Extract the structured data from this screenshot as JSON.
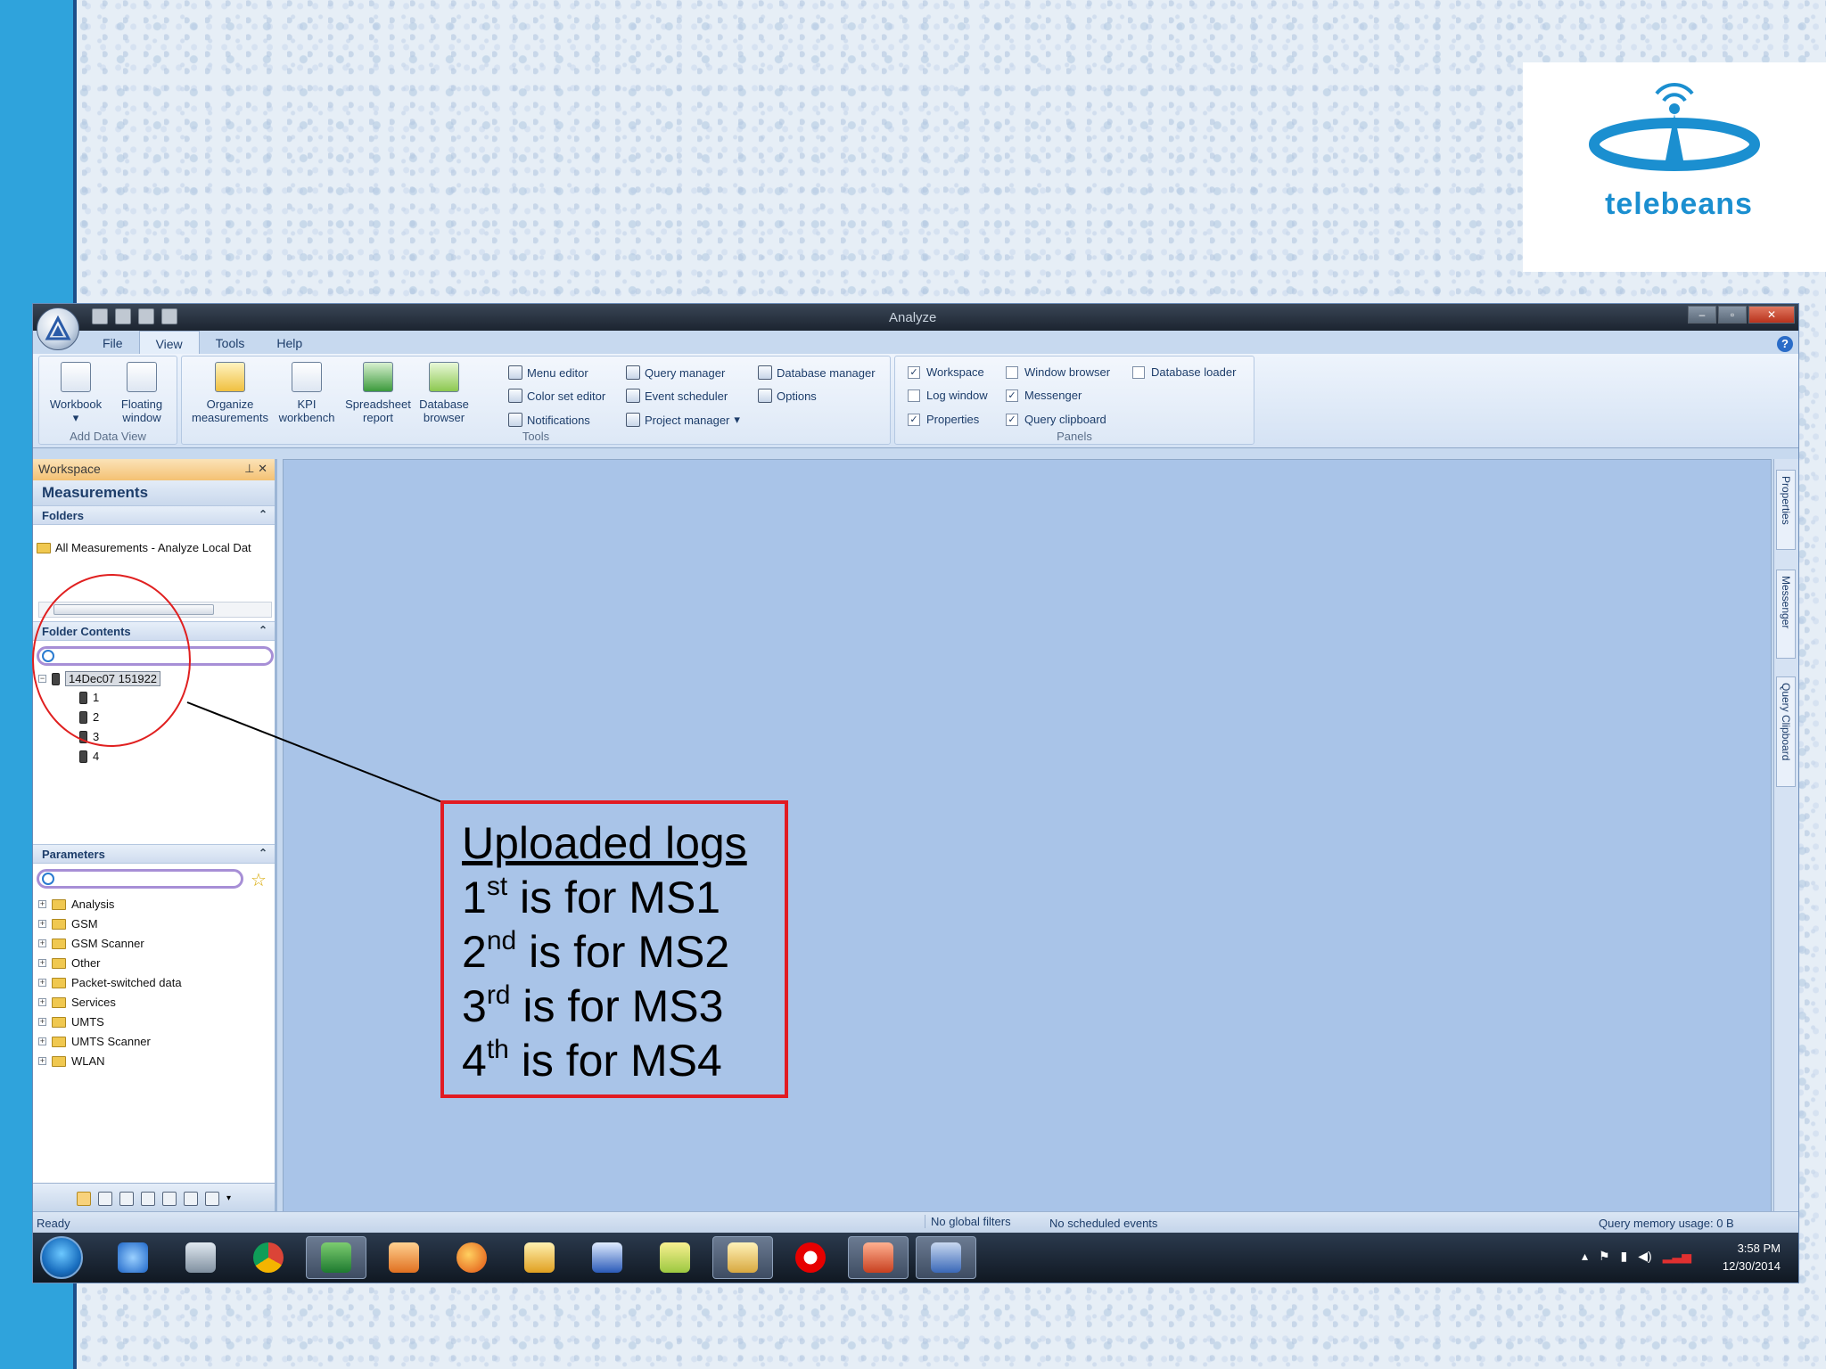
{
  "brand": {
    "logo_text": "telebeans"
  },
  "app": {
    "title": "Analyze",
    "menu_tabs": [
      {
        "label": "File"
      },
      {
        "label": "View"
      },
      {
        "label": "Tools"
      },
      {
        "label": "Help"
      }
    ],
    "active_tab": "View"
  },
  "ribbon": {
    "groups": [
      {
        "label": "Add Data View"
      },
      {
        "label": "Tools"
      },
      {
        "label": "Panels"
      }
    ],
    "add_data_view": {
      "workbook": "Workbook",
      "floating_window_1": "Floating",
      "floating_window_2": "window"
    },
    "tools_big": {
      "organize_1": "Organize",
      "organize_2": "measurements",
      "kpi_1": "KPI",
      "kpi_2": "workbench",
      "spreadsheet_1": "Spreadsheet",
      "spreadsheet_2": "report",
      "database_1": "Database",
      "database_2": "browser"
    },
    "tools_small": {
      "menu_editor": "Menu editor",
      "color_set_editor": "Color set editor",
      "notifications": "Notifications",
      "query_manager": "Query manager",
      "event_scheduler": "Event scheduler",
      "project_manager": "Project manager",
      "database_manager": "Database manager",
      "options": "Options"
    },
    "panels": [
      {
        "label": "Workspace",
        "checked": true
      },
      {
        "label": "Window browser",
        "checked": false
      },
      {
        "label": "Database loader",
        "checked": false
      },
      {
        "label": "Log window",
        "checked": false
      },
      {
        "label": "Messenger",
        "checked": true
      },
      {
        "label": "Properties",
        "checked": true
      },
      {
        "label": "Query clipboard",
        "checked": true
      }
    ]
  },
  "workspace": {
    "header": "Workspace",
    "title": "Measurements",
    "folders_header": "Folders",
    "folder_item": "All Measurements - Analyze Local Dat",
    "folder_contents_header": "Folder Contents",
    "log_name": "14Dec07 151922",
    "log_children": [
      "1",
      "2",
      "3",
      "4"
    ],
    "parameters_header": "Parameters",
    "parameters": [
      "Analysis",
      "GSM",
      "GSM Scanner",
      "Other",
      "Packet-switched data",
      "Services",
      "UMTS",
      "UMTS Scanner",
      "WLAN"
    ]
  },
  "side_tabs": [
    "Properties",
    "Messenger",
    "Query Clipboard"
  ],
  "status": {
    "left": "Ready",
    "filters": "No global filters",
    "events": "No scheduled events",
    "memory": "Query memory usage: 0 B"
  },
  "taskbar": {
    "time": "3:58 PM",
    "date": "12/30/2014"
  },
  "callout": {
    "heading": "Uploaded logs",
    "lines": [
      {
        "num": "1",
        "sup": "st",
        "text": " is for MS1"
      },
      {
        "num": "2",
        "sup": "nd",
        "text": " is for MS2"
      },
      {
        "num": "3",
        "sup": "rd",
        "text": " is for MS3"
      },
      {
        "num": "4",
        "sup": "th",
        "text": " is for MS4"
      }
    ]
  },
  "colors": {
    "left_bar": "#2fa3dc",
    "callout_border": "#e11b22",
    "main_area": "#a9c4e8",
    "workspace_header": "#f4c173"
  }
}
